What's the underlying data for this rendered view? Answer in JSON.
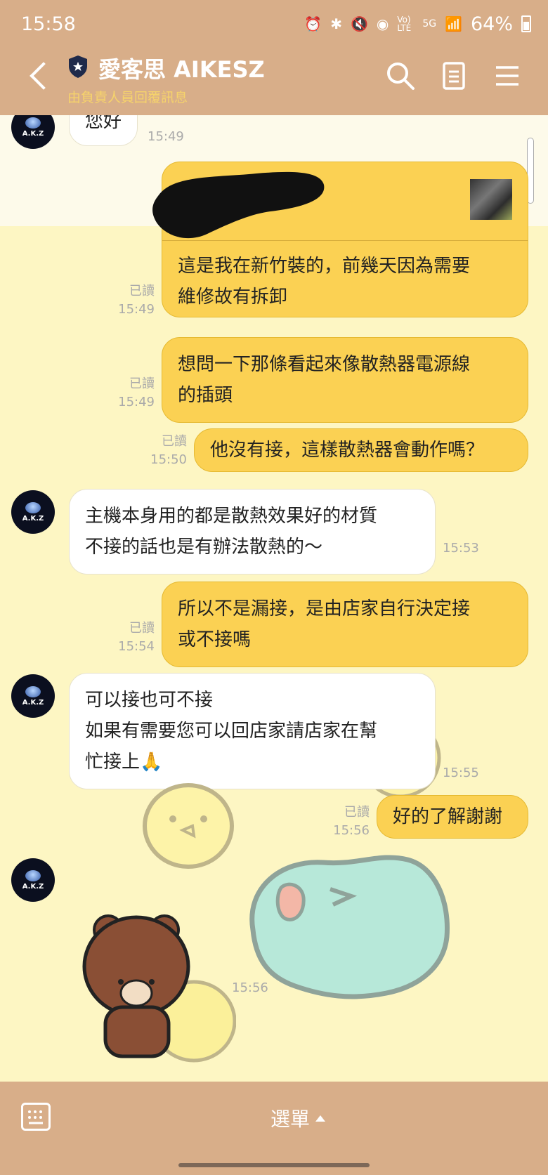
{
  "status_bar": {
    "time": "15:58",
    "battery": "64%",
    "icons": [
      "alarm-icon",
      "bluetooth-icon",
      "mute-icon",
      "hotspot-icon",
      "volte-icon",
      "5g-icon",
      "signal-icon",
      "battery-icon"
    ],
    "volte_label": "Vo) LTE",
    "network_label": "5G"
  },
  "header": {
    "title": "愛客思 AIKESZ",
    "subtitle": "由負責人員回覆訊息"
  },
  "avatar": {
    "text": "A.K.Z",
    "sub": "愛客思"
  },
  "messages": [
    {
      "dir": "in",
      "text": "您好",
      "time": "15:49"
    },
    {
      "dir": "out",
      "text_lines": [
        "這是我在新竹裝的，前幾天因為需要",
        "維修故有拆卸"
      ],
      "read": "已讀",
      "time": "15:49"
    },
    {
      "dir": "out",
      "text_lines": [
        "想問一下那條看起來像散熱器電源線",
        "的插頭"
      ],
      "read": "已讀",
      "time": "15:49"
    },
    {
      "dir": "out",
      "text": "他沒有接，這樣散熱器會動作嗎？",
      "read": "已讀",
      "time": "15:50"
    },
    {
      "dir": "in",
      "text_lines": [
        "主機本身用的都是散熱效果好的材質",
        "不接的話也是有辦法散熱的～"
      ],
      "time": "15:53"
    },
    {
      "dir": "out",
      "text_lines": [
        "所以不是漏接，是由店家自行決定接",
        "或不接嗎"
      ],
      "read": "已讀",
      "time": "15:54"
    },
    {
      "dir": "in",
      "text_lines": [
        "可以接也可不接",
        "如果有需要您可以回店家請店家在幫",
        "忙接上🙏"
      ],
      "time": "15:55"
    },
    {
      "dir": "out",
      "text": "好的了解謝謝",
      "read": "已讀",
      "time": "15:56"
    },
    {
      "dir": "in",
      "sticker": "brown-bear-bow",
      "time": "15:56"
    }
  ],
  "bottom": {
    "menu_label": "選單"
  },
  "colors": {
    "header_bg": "#d8ae89",
    "chat_bg": "#fdf6c3",
    "outgoing_bubble": "#fbd153",
    "incoming_bubble": "#ffffff"
  }
}
